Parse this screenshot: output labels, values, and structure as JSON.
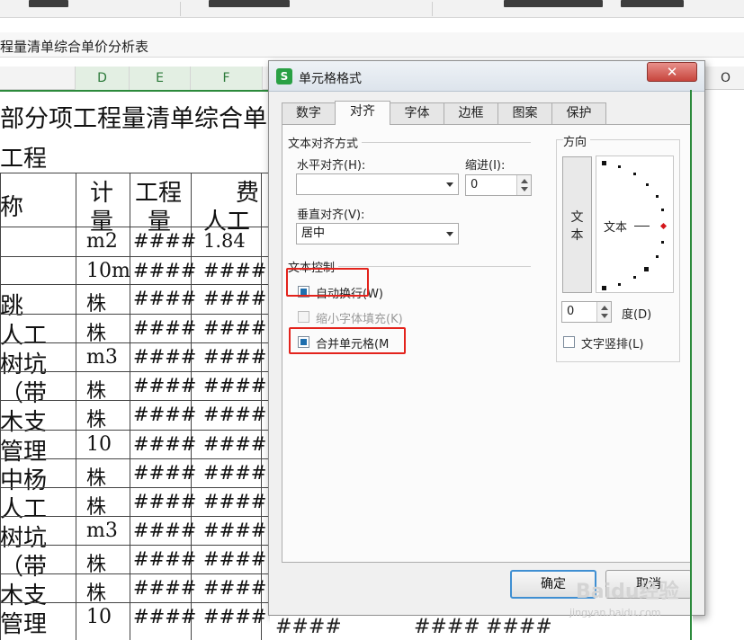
{
  "workbook": {
    "doc_title": "程量清单综合单价分析表",
    "columns": [
      "D",
      "E",
      "F",
      "O"
    ],
    "title_text": "部分项工程量清单综合单",
    "subtitle_text": "工程",
    "header": {
      "name_frag": "称",
      "unit": [
        "计",
        "量"
      ],
      "qty": [
        "工程",
        "量"
      ],
      "fee": "费",
      "labor": "人工"
    },
    "rows": [
      {
        "name": "",
        "unit": "m2",
        "qty": "####",
        "labor": "1.84"
      },
      {
        "name": "",
        "unit": "10m",
        "qty": "####",
        "labor": "####"
      },
      {
        "name": "跳",
        "unit": "株",
        "qty": "####",
        "labor": "####"
      },
      {
        "name": "人工",
        "unit": "株",
        "qty": "####",
        "labor": "####"
      },
      {
        "name": "树坑",
        "unit": "m3",
        "qty": "####",
        "labor": "####"
      },
      {
        "name": "（带",
        "unit": "株",
        "qty": "####",
        "labor": "####"
      },
      {
        "name": "木支",
        "unit": "株",
        "qty": "####",
        "labor": "####"
      },
      {
        "name": "管理",
        "unit": "10",
        "qty": "####",
        "labor": "####"
      },
      {
        "name": "中杨",
        "unit": "株",
        "qty": "####",
        "labor": "####"
      },
      {
        "name": "人工",
        "unit": "株",
        "qty": "####",
        "labor": "####"
      },
      {
        "name": "树坑",
        "unit": "m3",
        "qty": "####",
        "labor": "####"
      },
      {
        "name": "（带",
        "unit": "株",
        "qty": "####",
        "labor": "####"
      },
      {
        "name": "木支",
        "unit": "株",
        "qty": "####",
        "labor": "####"
      },
      {
        "name": "管理",
        "unit": "10",
        "qty": "####",
        "labor": "####"
      }
    ],
    "behind_dialog_row": [
      "####",
      "####",
      "####"
    ]
  },
  "dialog": {
    "app_icon": "S",
    "title": "单元格格式",
    "close_label": "✕",
    "tabs": [
      "数字",
      "对齐",
      "字体",
      "边框",
      "图案",
      "保护"
    ],
    "active_tab": "对齐",
    "text_alignment": {
      "group_title": "文本对齐方式",
      "horizontal_label": "水平对齐(H):",
      "horizontal_value": "",
      "indent_label": "缩进(I):",
      "indent_value": "0",
      "vertical_label": "垂直对齐(V):",
      "vertical_value": "居中"
    },
    "text_control": {
      "group_title": "文本控制",
      "wrap_text": {
        "label": "自动换行(W)",
        "checked": true
      },
      "shrink_to_fit": {
        "label": "缩小字体填充(K)",
        "checked": false,
        "disabled": true
      },
      "merge_cells": {
        "label": "合并单元格(M",
        "checked": true
      }
    },
    "orientation": {
      "group_title": "方向",
      "vertical_text_chars": [
        "文",
        "本"
      ],
      "dial_text": "文本",
      "degree_value": "0",
      "degree_label": "度(D)",
      "vertical_layout_label": "文字竖排(L)",
      "vertical_layout_checked": false
    },
    "ok_label": "确定",
    "cancel_label": "取消"
  },
  "colors": {
    "highlight": "#e3231c",
    "accent": "#1f6fae",
    "app_icon": "#29a045"
  },
  "watermark": {
    "text": "Baidu经验",
    "sub": "jingyan.baidu.com"
  }
}
